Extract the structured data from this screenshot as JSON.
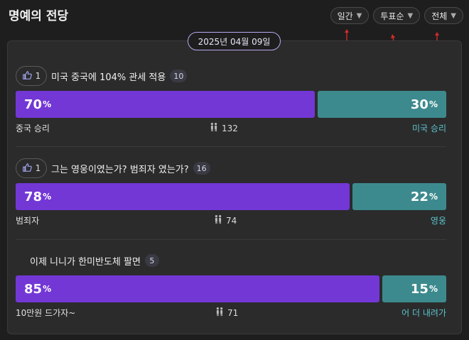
{
  "header": {
    "title": "명예의 전당",
    "filters": [
      {
        "label": "일간"
      },
      {
        "label": "투표순"
      },
      {
        "label": "전체"
      }
    ]
  },
  "date": "2025년 04월 09일",
  "polls": [
    {
      "likes": "1",
      "title": "미국 중국에 104% 관세 적용",
      "comments": "10",
      "left_pct": 70,
      "right_pct": 30,
      "left_pct_text": "70",
      "right_pct_text": "30",
      "left_label": "중국 승리",
      "right_label": "미국 승리",
      "voters": "132"
    },
    {
      "likes": "1",
      "title": "그는 영웅이였는가? 범죄자 였는가?",
      "comments": "16",
      "left_pct": 78,
      "right_pct": 22,
      "left_pct_text": "78",
      "right_pct_text": "22",
      "left_label": "범죄자",
      "right_label": "영웅",
      "voters": "74"
    },
    {
      "likes": "",
      "title": "이제 니니가 한미반도체 팔면",
      "comments": "5",
      "left_pct": 85,
      "right_pct": 15,
      "left_pct_text": "85",
      "right_pct_text": "15",
      "left_label": "10만원 드가자~",
      "right_label": "어 더 내려가",
      "voters": "71"
    }
  ],
  "pct_sign": "%",
  "colors": {
    "left_bar": "#7337d6",
    "right_bar": "#3d8a8e",
    "right_label": "#5cc3cc"
  },
  "icons": {
    "like": "thumbs-up-icon",
    "voters": "people-icon",
    "caret": "caret-down-icon"
  }
}
